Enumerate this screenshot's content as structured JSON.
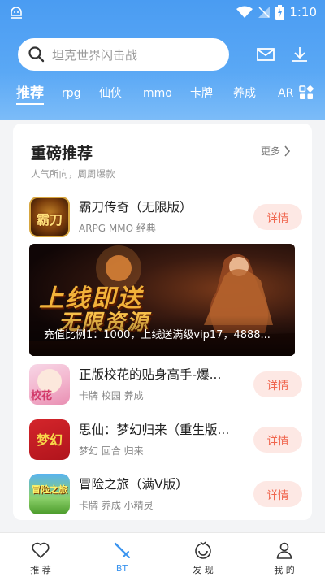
{
  "status_bar": {
    "time": "1:10"
  },
  "search": {
    "placeholder": "坦克世界闪击战"
  },
  "tabs": [
    {
      "label": "推荐",
      "active": true
    },
    {
      "label": "rpg"
    },
    {
      "label": "仙侠"
    },
    {
      "label": "mmo"
    },
    {
      "label": "卡牌"
    },
    {
      "label": "养成"
    },
    {
      "label": "AR"
    }
  ],
  "section": {
    "title": "重磅推荐",
    "subtitle": "人气所向，周周爆款",
    "more_label": "更多"
  },
  "games": [
    {
      "name": "霸刀传奇（无限版）",
      "tags": "ARPG MMO 经典",
      "button": "详情",
      "icon_text": "霸刀"
    },
    {
      "name": " 正版校花的贴身高手-爆...",
      "tags": "卡牌 校园 养成",
      "button": "详情",
      "icon_text": "校花"
    },
    {
      "name": "思仙：梦幻归来（重生版...",
      "tags": "梦幻 回合 归来",
      "button": "详情",
      "icon_text": "梦幻"
    },
    {
      "name": "冒险之旅（满V版）",
      "tags": "卡牌 养成 小精灵",
      "button": "详情",
      "icon_text": "冒险之旅"
    }
  ],
  "banner": {
    "headline_1": "上线即送",
    "headline_2": "无限资源",
    "caption": "充值比例1：1000，上线送满级vip17，4888..."
  },
  "bottom_nav": [
    {
      "label": "推 荐",
      "icon": "heart-icon"
    },
    {
      "label": "BT",
      "icon": "sword-icon",
      "active": true
    },
    {
      "label": "发 现",
      "icon": "discover-icon"
    },
    {
      "label": "我 的",
      "icon": "user-icon"
    }
  ],
  "colors": {
    "header_blue": "#4a9cf2",
    "accent_red": "#f0664e",
    "detail_bg": "#fde8e4",
    "nav_active": "#3b94ef"
  }
}
